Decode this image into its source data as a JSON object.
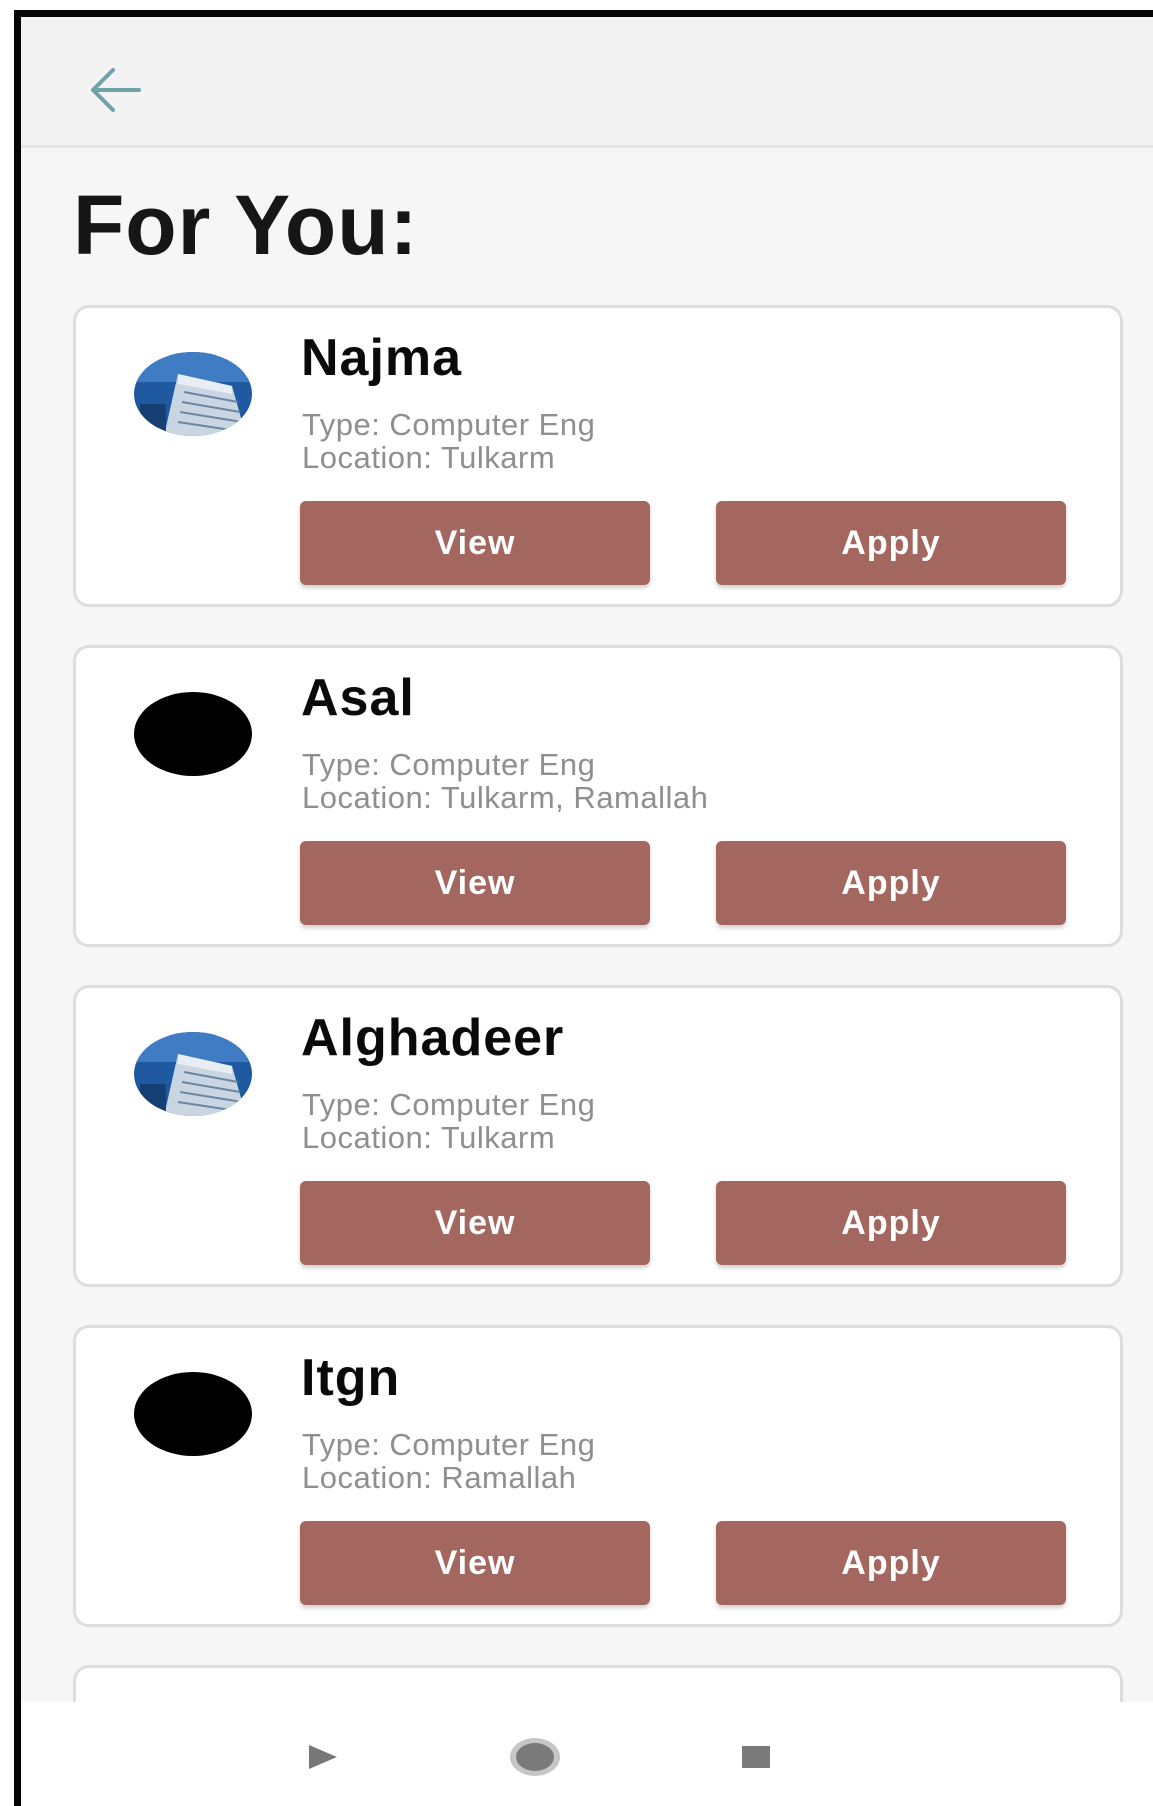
{
  "header": {
    "back_icon": "arrow-left-icon",
    "back_color": "#6fa3a8"
  },
  "page_title": "For You:",
  "colors": {
    "button": "#a3675f",
    "button_text": "#ffffff"
  },
  "cards": [
    {
      "name": "Najma",
      "type": "Type: Computer Eng",
      "location": "Location: Tulkarm",
      "avatar": "building-photo",
      "view_label": "View",
      "apply_label": "Apply"
    },
    {
      "name": "Asal",
      "type": "Type: Computer Eng",
      "location": "Location: Tulkarm, Ramallah",
      "avatar": "black-circle",
      "view_label": "View",
      "apply_label": "Apply"
    },
    {
      "name": "Alghadeer",
      "type": "Type: Computer Eng",
      "location": "Location: Tulkarm",
      "avatar": "building-photo",
      "view_label": "View",
      "apply_label": "Apply"
    },
    {
      "name": "Itgn",
      "type": "Type: Computer Eng",
      "location": "Location: Ramallah",
      "avatar": "black-circle",
      "view_label": "View",
      "apply_label": "Apply"
    }
  ],
  "navbar": {
    "icons": [
      "back-triangle-icon",
      "home-circle-icon",
      "recents-square-icon"
    ]
  }
}
